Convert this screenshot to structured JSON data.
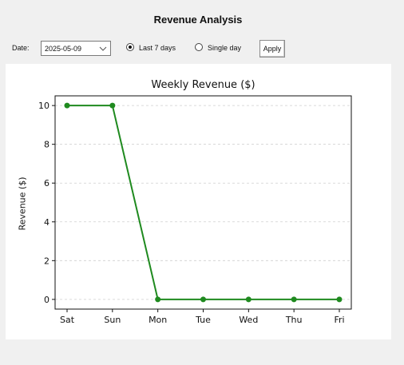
{
  "window": {
    "title": "Revenue Analysis"
  },
  "controls": {
    "date_label": "Date:",
    "date_value": "2025-05-09",
    "radio_last7_label": "Last 7 days",
    "radio_last7_selected": true,
    "radio_single_label": "Single day",
    "radio_single_selected": false,
    "apply_label": "Apply"
  },
  "icons": {
    "date_dropdown": "chevron-down-icon"
  },
  "chart_data": {
    "type": "line",
    "title": "Weekly Revenue ($)",
    "xlabel": "",
    "ylabel": "Revenue ($)",
    "categories": [
      "Sat",
      "Sun",
      "Mon",
      "Tue",
      "Wed",
      "Thu",
      "Fri"
    ],
    "series": [
      {
        "values": [
          10,
          10,
          0,
          0,
          0,
          0,
          0
        ],
        "color": "#1f8a1f",
        "marker": "circle"
      }
    ],
    "ylim": [
      -0.5,
      10.5
    ],
    "yticks": [
      0,
      2,
      4,
      6,
      8,
      10
    ],
    "grid": "horizontal-dashed",
    "legend": "none"
  }
}
